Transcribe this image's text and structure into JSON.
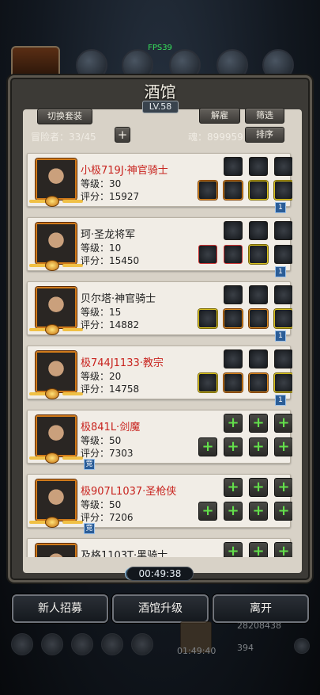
{
  "fps": "FPS39",
  "title": "酒馆",
  "level": "LV.58",
  "buttons": {
    "switch_set": "切换套装",
    "hire": "解雇",
    "filter": "筛选",
    "sort": "排序",
    "plus": "+"
  },
  "adventurer_count": "冒险者：33/45",
  "soul": "魂：899959",
  "heroes": [
    {
      "name": "小极719J·神官骑士",
      "name_color": "red",
      "level": "等级：30",
      "score": "评分：15927",
      "badge": "1",
      "equip": "gear"
    },
    {
      "name": "珂·圣龙将军",
      "name_color": "dark",
      "level": "等级：10",
      "score": "评分：15450",
      "badge": "1",
      "equip": "gear"
    },
    {
      "name": "贝尔塔·神官骑士",
      "name_color": "dark",
      "level": "等级：15",
      "score": "评分：14882",
      "badge": "1",
      "equip": "gear"
    },
    {
      "name": "极744J1133·教宗",
      "name_color": "red",
      "level": "等级：20",
      "score": "评分：14758",
      "badge": "1",
      "equip": "gear"
    },
    {
      "name": "极841L·剑魔",
      "name_color": "red",
      "level": "等级：50",
      "score": "评分：7303",
      "badge": "竞",
      "equip": "empty"
    },
    {
      "name": "极907L1037·圣枪侠",
      "name_color": "red",
      "level": "等级：50",
      "score": "评分：7206",
      "badge": "竞",
      "equip": "empty"
    },
    {
      "name": "及格1103T·黑骑士",
      "name_color": "dark",
      "level": "",
      "score": "",
      "badge": "",
      "equip": "empty"
    }
  ],
  "timer": "00:49:38",
  "bottom_buttons": {
    "recruit": "新人招募",
    "upgrade": "酒馆升级",
    "leave": "离开"
  },
  "footer": {
    "gold": "28208438",
    "timer": "01:49:40",
    "gems": "394"
  }
}
